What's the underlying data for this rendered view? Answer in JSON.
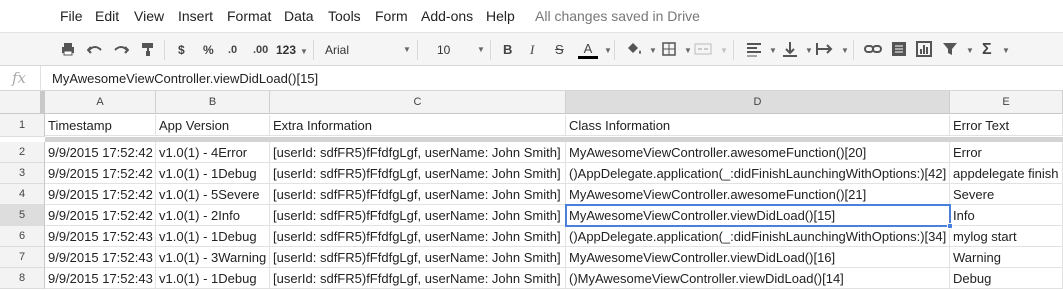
{
  "menu": {
    "items": [
      "File",
      "Edit",
      "View",
      "Insert",
      "Format",
      "Data",
      "Tools",
      "Form",
      "Add-ons",
      "Help"
    ],
    "status": "All changes saved in Drive"
  },
  "toolbar": {
    "currency": "$",
    "percent": "%",
    "decrease_decimal": ".0",
    "increase_decimal": ".00",
    "number_format": "123",
    "font": "Arial",
    "font_size": "10",
    "bold": "B",
    "italic": "I",
    "strike": "S",
    "text_color": "A",
    "text_color_value": "#000000",
    "sum": "Σ"
  },
  "formula_bar": {
    "fx_label": "fx",
    "content": "MyAwesomeViewController.viewDidLoad()[15]"
  },
  "sheet": {
    "columns": [
      "A",
      "B",
      "C",
      "D",
      "E"
    ],
    "row_numbers": [
      "1",
      "2",
      "3",
      "4",
      "5",
      "6",
      "7",
      "8"
    ],
    "active_cell": "D5",
    "rows": [
      [
        "Timestamp",
        "App Version",
        "Extra Information",
        "Class Information",
        "Error Text"
      ],
      [
        "9/9/2015 17:52:42",
        "v1.0(1) - 4Error",
        "[userId: sdfFR5)fFfdfgLgf, userName: John Smith]",
        "MyAwesomeViewController.awesomeFunction()[20]",
        "Error"
      ],
      [
        "9/9/2015 17:52:42",
        "v1.0(1) - 1Debug",
        "[userId: sdfFR5)fFfdfgLgf, userName: John Smith]",
        "()AppDelegate.application(_:didFinishLaunchingWithOptions:)[42]",
        "appdelegate finish"
      ],
      [
        "9/9/2015 17:52:42",
        "v1.0(1) - 5Severe",
        "[userId: sdfFR5)fFfdfgLgf, userName: John Smith]",
        "MyAwesomeViewController.awesomeFunction()[21]",
        "Severe"
      ],
      [
        "9/9/2015 17:52:42",
        "v1.0(1) - 2Info",
        "[userId: sdfFR5)fFfdfgLgf, userName: John Smith]",
        "MyAwesomeViewController.viewDidLoad()[15]",
        "Info"
      ],
      [
        "9/9/2015 17:52:43",
        "v1.0(1) - 1Debug",
        "[userId: sdfFR5)fFfdfgLgf, userName: John Smith]",
        "()AppDelegate.application(_:didFinishLaunchingWithOptions:)[34]",
        "mylog start"
      ],
      [
        "9/9/2015 17:52:43",
        "v1.0(1) - 3Warning",
        "[userId: sdfFR5)fFfdfgLgf, userName: John Smith]",
        "MyAwesomeViewController.viewDidLoad()[16]",
        "Warning"
      ],
      [
        "9/9/2015 17:52:43",
        "v1.0(1) - 1Debug",
        "[userId: sdfFR5)fFfdfgLgf, userName: John Smith]",
        "()MyAwesomeViewController.viewDidLoad()[14]",
        "Debug"
      ]
    ]
  },
  "colors": {
    "selection": "#4a7fde",
    "header_bg": "#f3f3f3",
    "status_text": "#777777"
  }
}
